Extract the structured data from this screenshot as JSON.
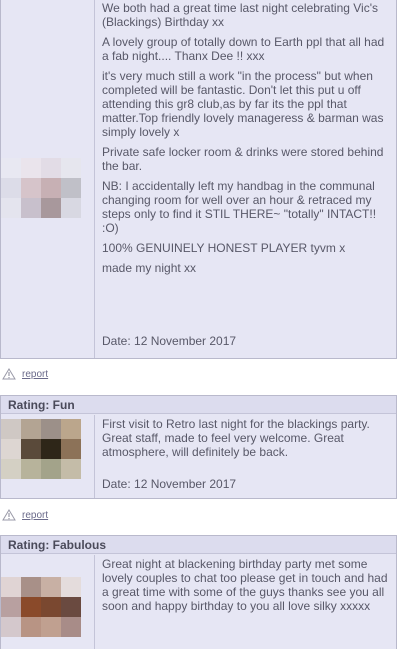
{
  "review1": {
    "paragraphs": [
      "We both had a great time last night celebrating Vic's (Blackings) Birthday xx",
      "A lovely group of totally down to Earth ppl that all had a fab night.... Thanx Dee !! xxx",
      "it's very much still a work \"in the process\" but when completed will be fantastic. Don't let this put u off attending this gr8 club,as by far its the ppl that matter.Top friendly lovely manageress & barman was simply lovely x",
      "Private safe locker room & drinks were stored behind the bar.",
      "NB: I accidentally left my handbag in the communal changing room for well over an hour & retraced my steps only to find it STIL THERE~ \"totally\" INTACT!! :O)",
      "100% GENUINELY HONEST PLAYER tyvm x",
      "made my night xx"
    ],
    "date": "Date: 12 November 2017",
    "avatar_colors": [
      "#e8e8f2",
      "#eae4ec",
      "#e2dce6",
      "#e6e6ee",
      "#dcdce8",
      "#d6c4ca",
      "#c7b0b4",
      "#c0c0c8",
      "#e4e4ee",
      "#c8c0cc",
      "#a8989c",
      "#d8d8e2"
    ]
  },
  "report1": {
    "label": "report"
  },
  "review2": {
    "rating": "Rating: Fun",
    "text": "First visit to Retro last night for the blackings party. Great staff, made to feel very welcome. Great atmosphere, will definitely be back.",
    "date": "Date: 12 November 2017",
    "avatar_colors": [
      "#cfc8c4",
      "#b3a493",
      "#9c9089",
      "#bba68c",
      "#ddd6d2",
      "#5a4a3a",
      "#2e2618",
      "#8c7258",
      "#d4d0c4",
      "#b7b39b",
      "#a3a38a",
      "#c4bca8"
    ]
  },
  "report2": {
    "label": "report"
  },
  "review3": {
    "rating": "Rating: Fabulous",
    "text": "Great night at blackening birthday party met some lovely couples to chat too please get in touch and had a great time with some of the guys thanks see you all soon and happy birthday to you all love silky xxxxx",
    "avatar_colors": [
      "#e0d4d4",
      "#a89088",
      "#c8b0a4",
      "#e4dcdc",
      "#b8a0a0",
      "#8a4a2a",
      "#7a4830",
      "#6a4a40",
      "#d4c8cc",
      "#b89484",
      "#c0a090",
      "#a88c88"
    ]
  },
  "colors": {
    "panel": "#e6e6f4",
    "border": "#b9b9cc",
    "link": "#6a6a8a"
  }
}
